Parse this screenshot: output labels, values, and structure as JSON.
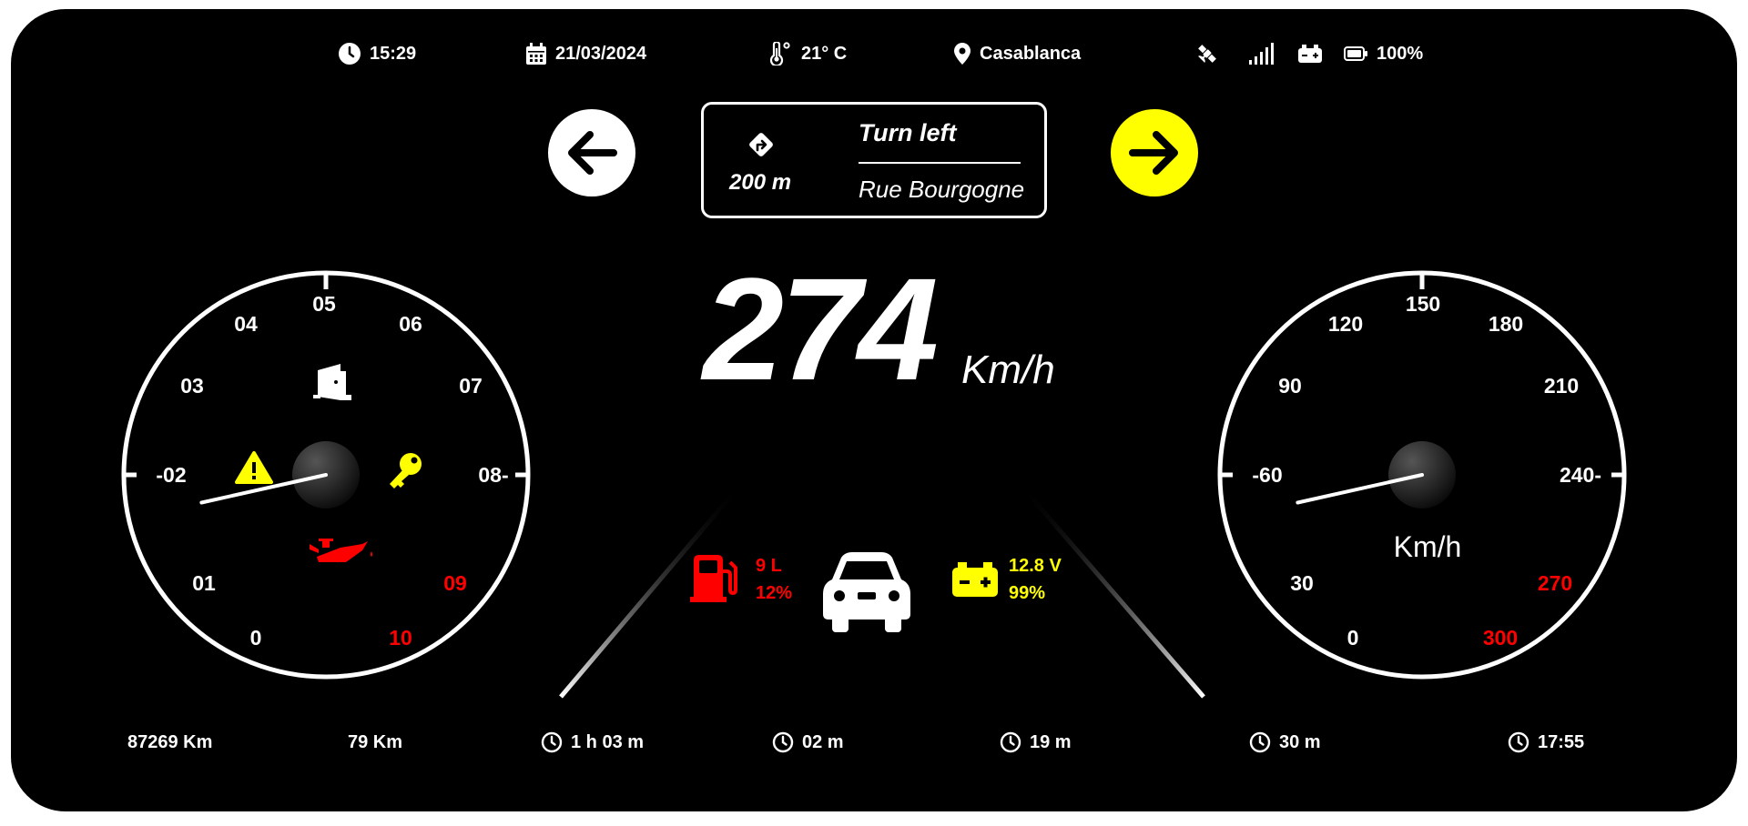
{
  "status_bar": {
    "time": "15:29",
    "date": "21/03/2024",
    "temperature": "21° C",
    "location": "Casablanca",
    "battery_percent": "100%"
  },
  "navigation": {
    "distance": "200 m",
    "action": "Turn left",
    "street": "Rue Bourgogne"
  },
  "speed": {
    "value": "274",
    "unit": "Km/h"
  },
  "left_gauge": {
    "ticks": [
      "0",
      "01",
      "-02",
      "03",
      "04",
      "05",
      "06",
      "07",
      "08-",
      "09",
      "10"
    ],
    "needle_fraction": 0.12,
    "warning_color": "#ff0000",
    "alert_color": "#ffff00"
  },
  "right_gauge": {
    "ticks": [
      "0",
      "30",
      "-60",
      "90",
      "120",
      "150",
      "180",
      "210",
      "240-",
      "270",
      "300"
    ],
    "unit": "Km/h",
    "needle_fraction": 0.12
  },
  "fuel": {
    "liters": "9 L",
    "percent": "12%",
    "color": "#ff0000"
  },
  "battery": {
    "voltage": "12.8 V",
    "percent": "99%",
    "color": "#ffff00"
  },
  "bottom_bar": {
    "odometer": "87269 Km",
    "trip": "79 Km",
    "t1": "1 h 03 m",
    "t2": "02 m",
    "t3": "19 m",
    "t4": "30 m",
    "t5": "17:55"
  },
  "colors": {
    "background": "#000000",
    "accent": "#ffff00",
    "danger": "#ff0000",
    "foreground": "#ffffff"
  }
}
